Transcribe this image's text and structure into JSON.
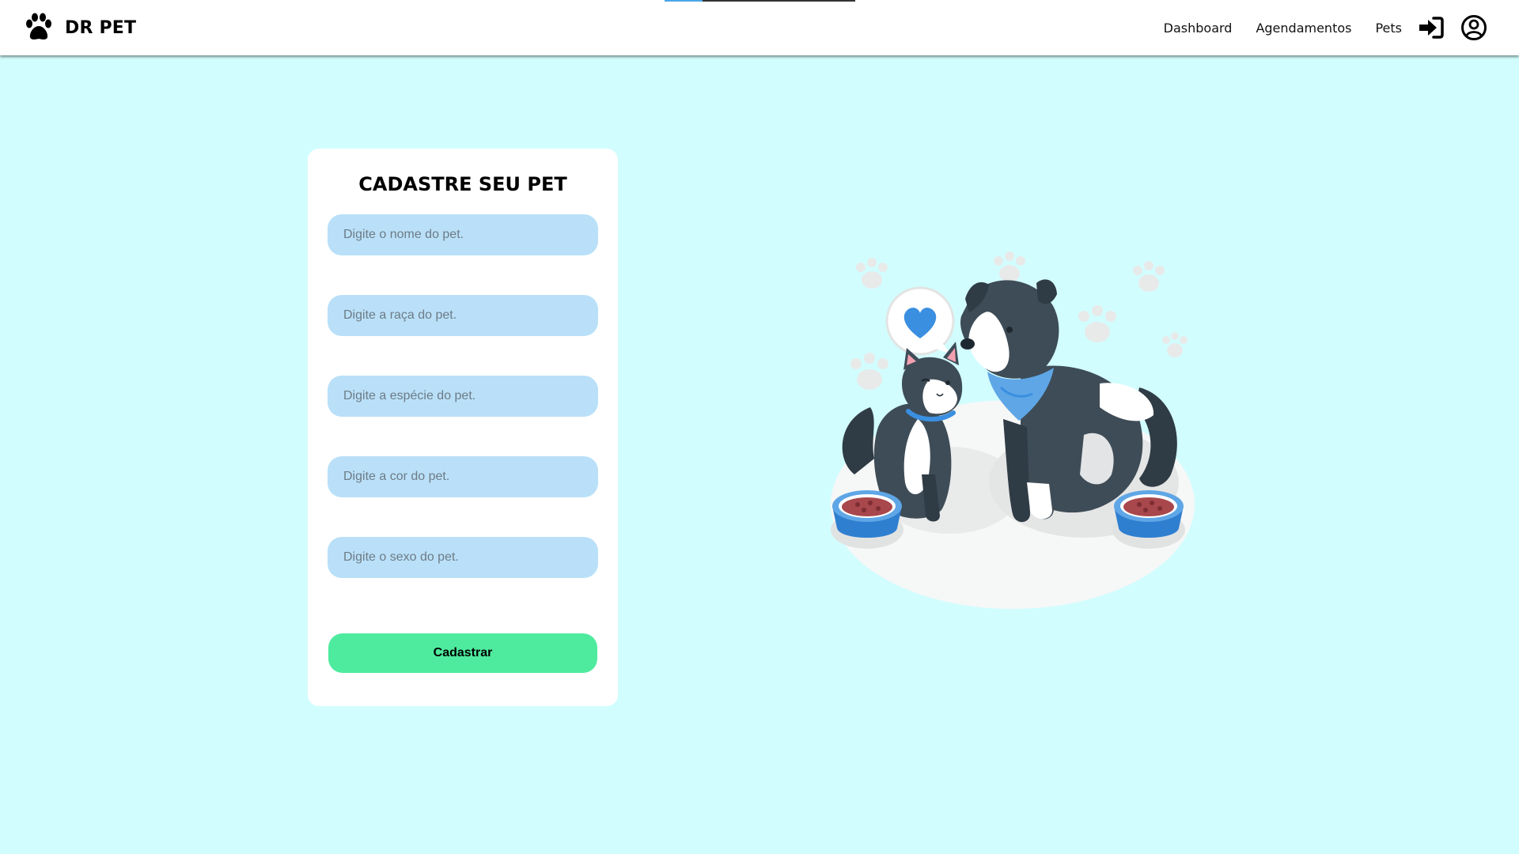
{
  "navbar": {
    "brand": "DR PET",
    "links": [
      {
        "label": "Dashboard"
      },
      {
        "label": "Agendamentos"
      },
      {
        "label": "Pets"
      }
    ],
    "icons": [
      "paw-icon",
      "login-icon",
      "user-circle-icon"
    ]
  },
  "form": {
    "title": "CADASTRE SEU PET",
    "fields": [
      {
        "placeholder": "Digite o nome do pet.",
        "value": ""
      },
      {
        "placeholder": "Digite a raça do pet.",
        "value": ""
      },
      {
        "placeholder": "Digite a espécie do pet.",
        "value": ""
      },
      {
        "placeholder": "Digite a cor do pet.",
        "value": ""
      },
      {
        "placeholder": "Digite o sexo do pet.",
        "value": ""
      }
    ],
    "submit_label": "Cadastrar"
  },
  "colors": {
    "page_background": "#d2fdfe",
    "input_background": "#b9e0f8",
    "button_background": "#4eeb9f",
    "accent_blue": "#4aa8e8"
  }
}
